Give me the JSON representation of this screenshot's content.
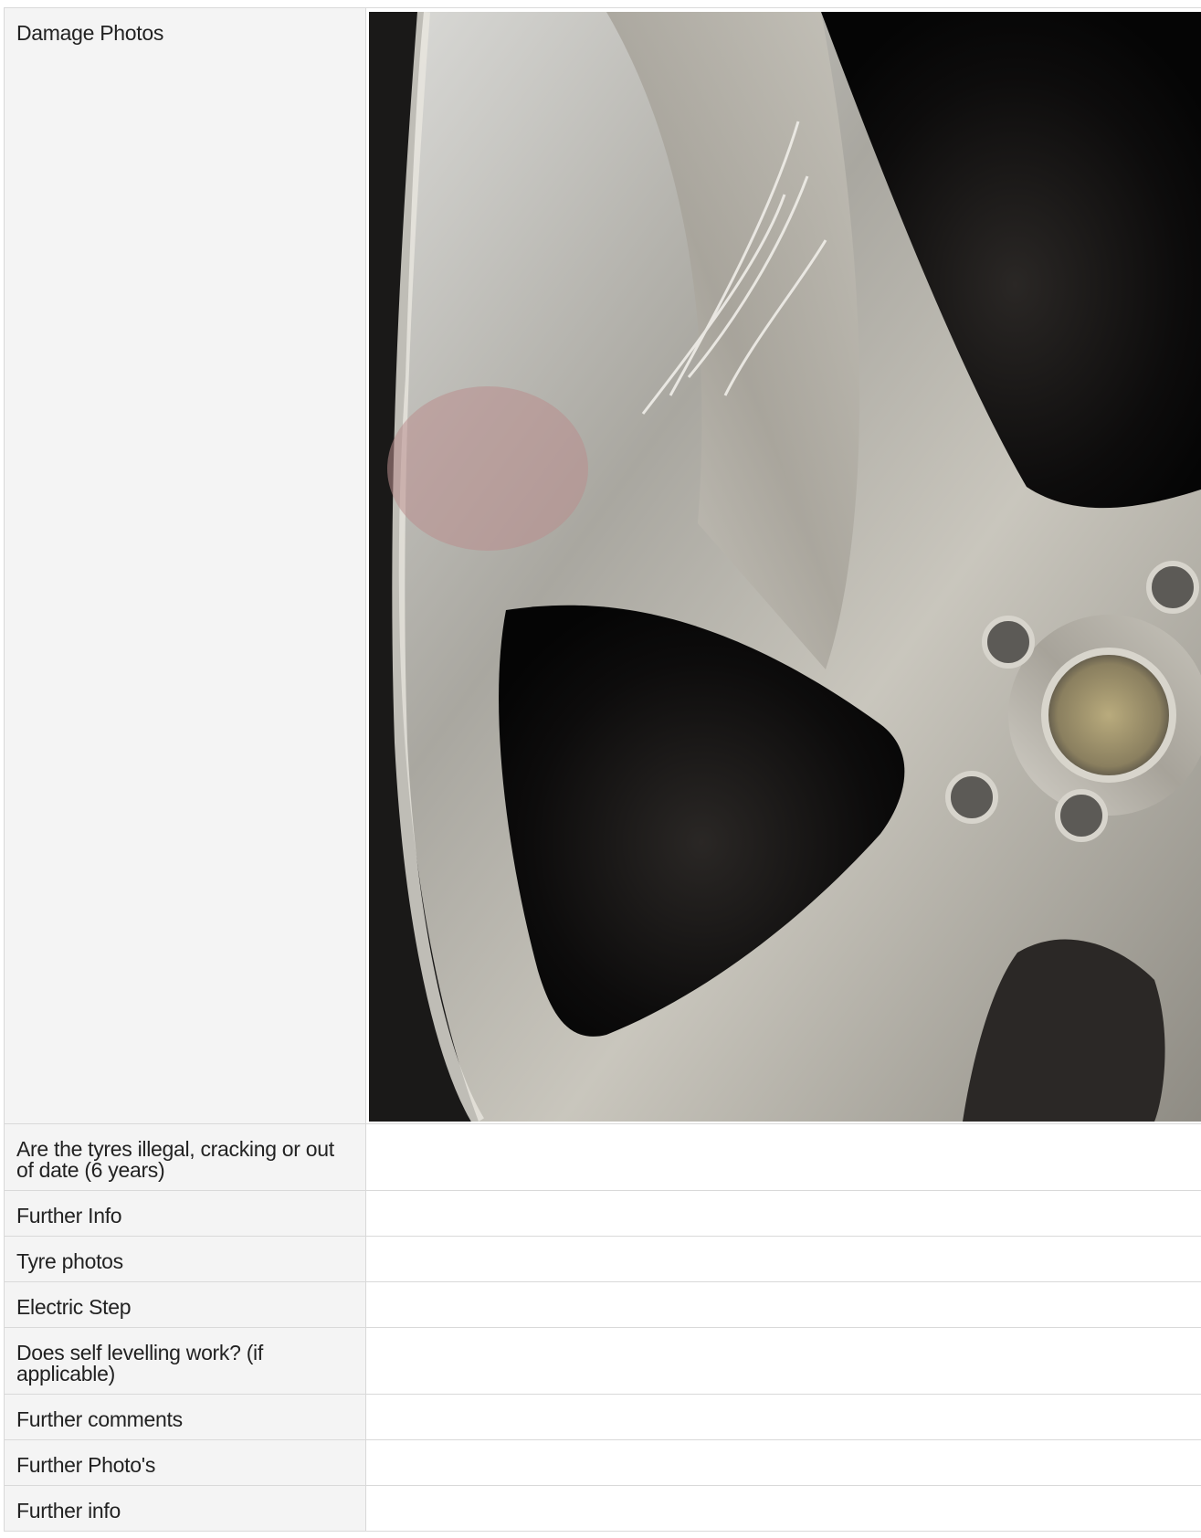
{
  "rows": [
    {
      "label": "Damage Photos",
      "value": "",
      "has_photo": true
    },
    {
      "label": "Are the tyres illegal, cracking or out of date (6 years)",
      "value": ""
    },
    {
      "label": "Further Info",
      "value": ""
    },
    {
      "label": "Tyre photos",
      "value": ""
    },
    {
      "label": "Electric Step",
      "value": ""
    },
    {
      "label": "Does self levelling work? (if applicable)",
      "value": ""
    },
    {
      "label": "Further comments",
      "value": ""
    },
    {
      "label": "Further Photo's",
      "value": ""
    },
    {
      "label": "Further info",
      "value": ""
    }
  ],
  "photo": {
    "subject": "alloy-wheel-damage-photo"
  }
}
